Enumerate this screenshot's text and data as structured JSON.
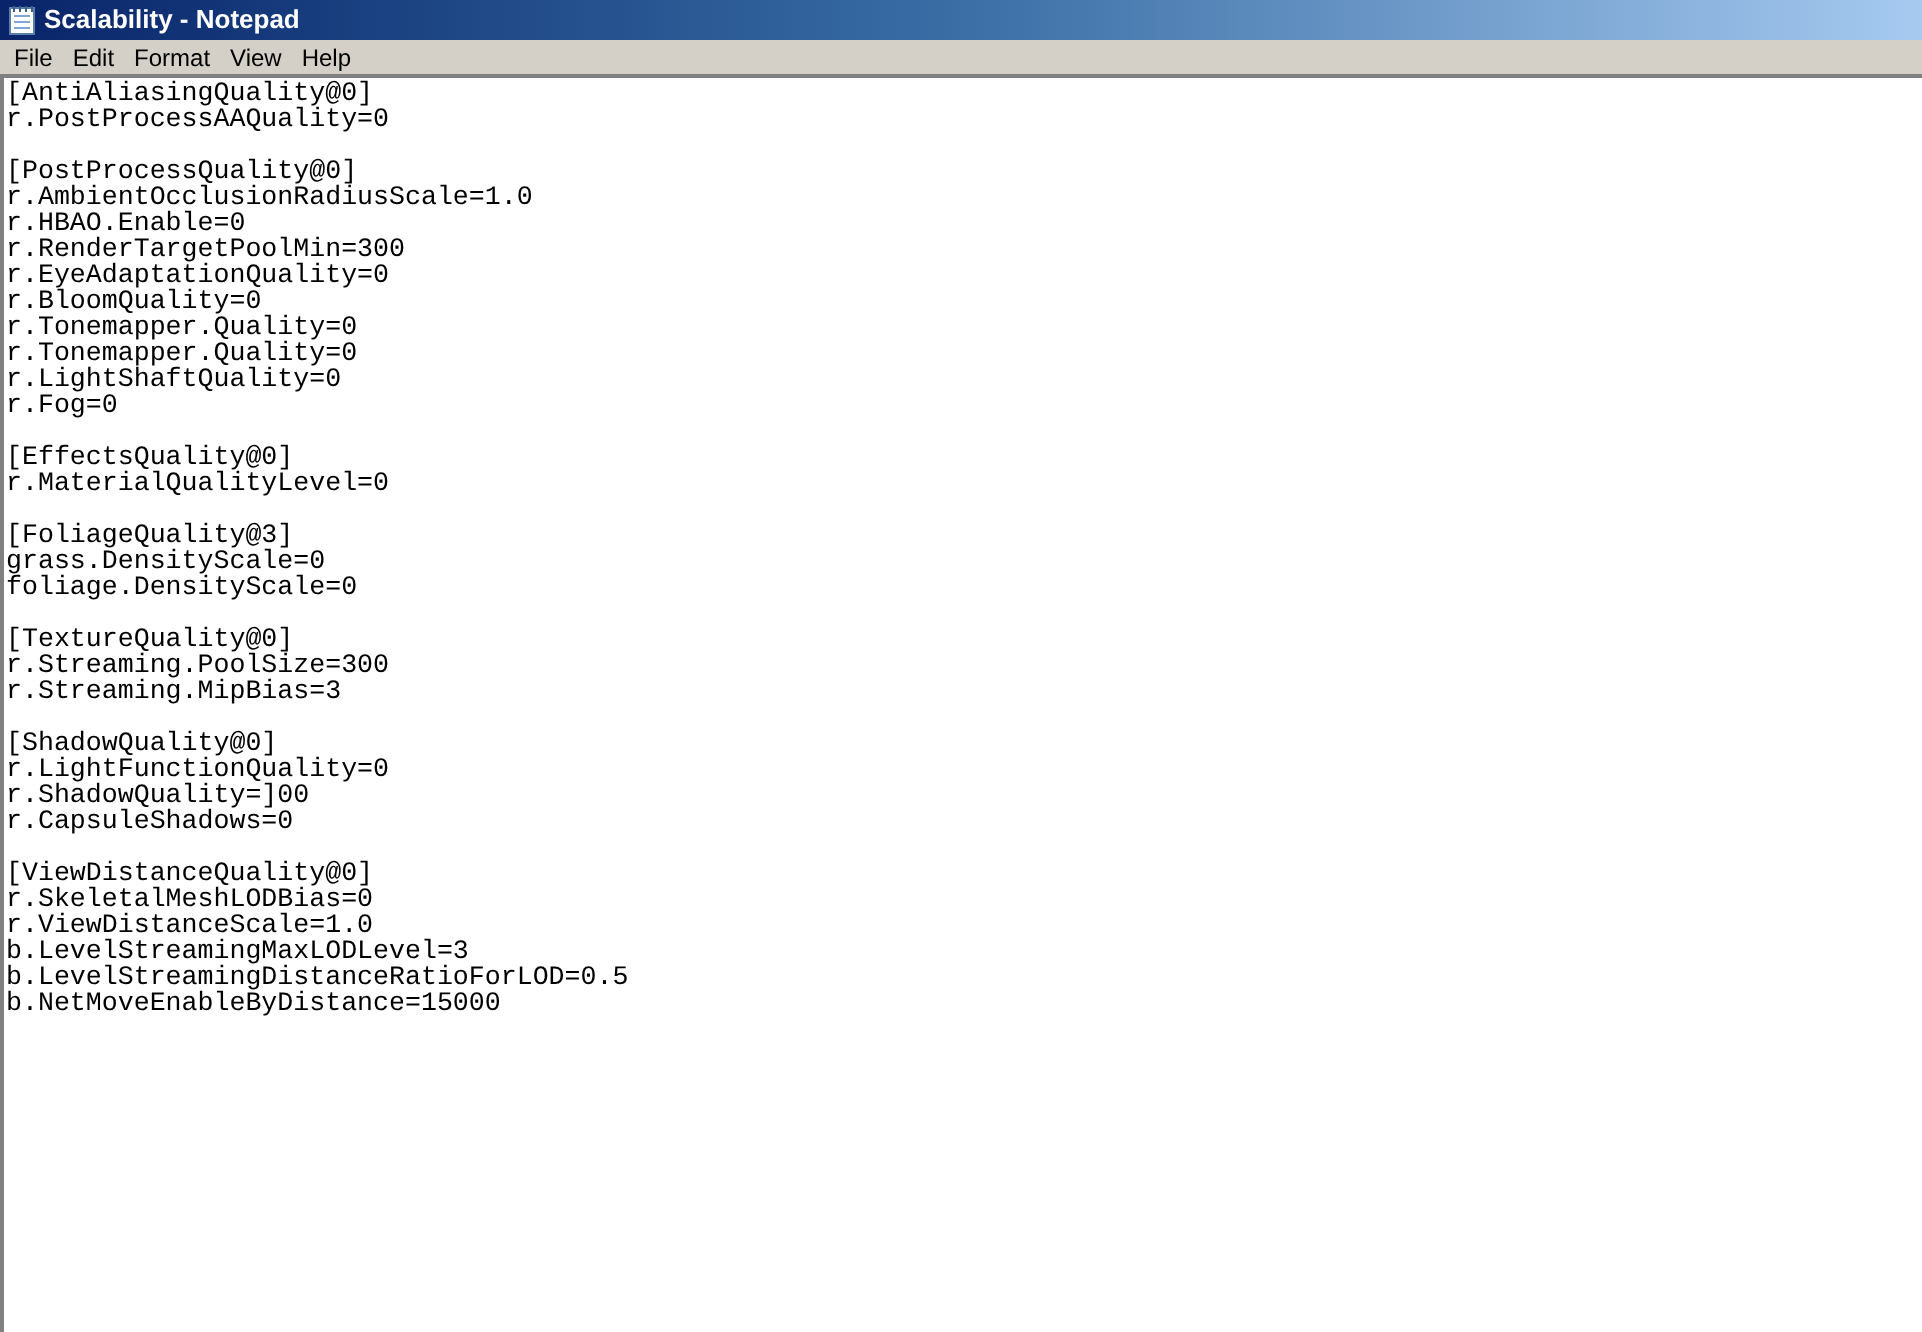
{
  "window": {
    "title": "Scalability - Notepad"
  },
  "menu": [
    "File",
    "Edit",
    "Format",
    "View",
    "Help"
  ],
  "sections": [
    {
      "header": "[AntiAliasingQuality@0]",
      "lines": [
        "r.PostProcessAAQuality=0"
      ]
    },
    {
      "header": "[PostProcessQuality@0]",
      "lines": [
        "r.AmbientOcclusionRadiusScale=1.0",
        "r.HBAO.Enable=0",
        "r.RenderTargetPoolMin=300",
        "r.EyeAdaptationQuality=0",
        "r.BloomQuality=0",
        "r.Tonemapper.Quality=0",
        "r.Tonemapper.Quality=0",
        "r.LightShaftQuality=0",
        "r.Fog=0"
      ]
    },
    {
      "header": "[EffectsQuality@0]",
      "lines": [
        "r.MaterialQualityLevel=0"
      ]
    },
    {
      "header": "[FoliageQuality@3]",
      "lines": [
        "grass.DensityScale=0",
        "foliage.DensityScale=0"
      ]
    },
    {
      "header": "[TextureQuality@0]",
      "lines": [
        "r.Streaming.PoolSize=300",
        "r.Streaming.MipBias=3"
      ]
    },
    {
      "header": "[ShadowQuality@0]",
      "lines": [
        "r.LightFunctionQuality=0",
        "r.ShadowQuality=]00",
        "r.CapsuleShadows=0"
      ]
    },
    {
      "header": "[ViewDistanceQuality@0]",
      "lines": [
        "r.SkeletalMeshLODBias=0",
        "r.ViewDistanceScale=1.0",
        "b.LevelStreamingMaxLODLevel=3",
        "b.LevelStreamingDistanceRatioForLOD=0.5",
        "b.NetMoveEnableByDistance=15000"
      ]
    }
  ]
}
